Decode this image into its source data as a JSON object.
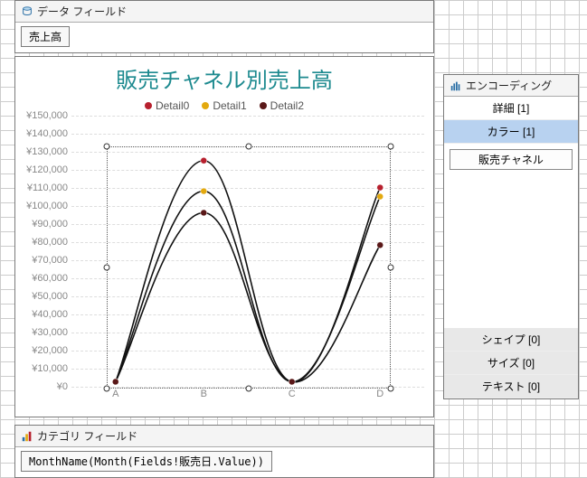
{
  "data_fields_panel": {
    "title": "データ フィールド",
    "items": [
      "売上高"
    ]
  },
  "chart_data": {
    "type": "line",
    "title": "販売チャネル別売上高",
    "categories": [
      "A",
      "B",
      "C",
      "D"
    ],
    "series": [
      {
        "name": "Detail0",
        "color": "#b7202e",
        "values": [
          2000,
          125000,
          2000,
          110000
        ]
      },
      {
        "name": "Detail1",
        "color": "#e3a90f",
        "values": [
          2000,
          108000,
          2000,
          105000
        ]
      },
      {
        "name": "Detail2",
        "color": "#5a1818",
        "values": [
          2000,
          96000,
          2000,
          78000
        ]
      }
    ],
    "ylim": [
      0,
      150000
    ],
    "y_ticks": [
      0,
      10000,
      20000,
      30000,
      40000,
      50000,
      60000,
      70000,
      80000,
      90000,
      100000,
      110000,
      120000,
      130000,
      140000,
      150000
    ],
    "y_prefix": "¥",
    "xlabel": "",
    "ylabel": ""
  },
  "category_panel": {
    "title": "カテゴリ フィールド",
    "expression": "MonthName(Month(Fields!販売日.Value))"
  },
  "encoding_panel": {
    "title": "エンコーディング",
    "top_items": [
      {
        "label": "詳細 [1]",
        "selected": false
      },
      {
        "label": "カラー [1]",
        "selected": true
      }
    ],
    "field_box": "販売チャネル",
    "bottom_items": [
      {
        "label": "シェイプ [0]"
      },
      {
        "label": "サイズ [0]"
      },
      {
        "label": "テキスト [0]"
      }
    ]
  }
}
